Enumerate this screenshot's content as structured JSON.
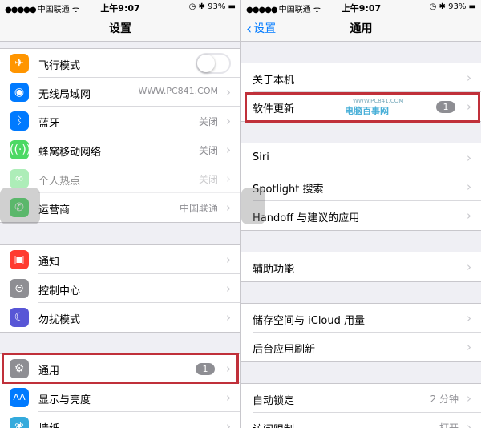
{
  "status_bar": {
    "carrier": "中国联通",
    "time": "上午9:07",
    "battery": "93%"
  },
  "left": {
    "title": "设置",
    "group1": [
      {
        "label": "飞行模式",
        "icon": "airplane-icon",
        "color": "#ff9500",
        "toggle": "off"
      },
      {
        "label": "无线局域网",
        "value": "WWW.PC841.COM",
        "icon": "wifi-icon",
        "color": "#007aff"
      },
      {
        "label": "蓝牙",
        "value": "关闭",
        "icon": "bluetooth-icon",
        "color": "#007aff"
      },
      {
        "label": "蜂窝移动网络",
        "value": "关闭",
        "icon": "cellular-icon",
        "color": "#4cd964"
      },
      {
        "label": "个人热点",
        "value": "关闭",
        "icon": "hotspot-icon",
        "color": "#4cd964"
      },
      {
        "label": "运营商",
        "value": "中国联通",
        "icon": "phone-icon",
        "color": "#4cd964"
      }
    ],
    "group2": [
      {
        "label": "通知",
        "icon": "notifications-icon",
        "color": "#ff3b30"
      },
      {
        "label": "控制中心",
        "icon": "control-center-icon",
        "color": "#8e8e93"
      },
      {
        "label": "勿扰模式",
        "icon": "moon-icon",
        "color": "#5856d6"
      }
    ],
    "group3": [
      {
        "label": "通用",
        "badge": "1",
        "icon": "gear-icon",
        "color": "#8e8e93"
      },
      {
        "label": "显示与亮度",
        "icon": "display-icon",
        "color": "#007aff"
      },
      {
        "label": "墙纸",
        "icon": "wallpaper-icon",
        "color": "#34aadc"
      }
    ]
  },
  "right": {
    "back_label": "设置",
    "title": "通用",
    "group1": [
      {
        "label": "关于本机"
      },
      {
        "label": "软件更新",
        "badge": "1"
      }
    ],
    "group2": [
      {
        "label": "Siri"
      },
      {
        "label": "Spotlight 搜索"
      },
      {
        "label": "Handoff 与建议的应用"
      }
    ],
    "group3": [
      {
        "label": "辅助功能"
      }
    ],
    "group4": [
      {
        "label": "储存空间与 iCloud 用量"
      },
      {
        "label": "后台应用刷新"
      }
    ],
    "group5": [
      {
        "label": "自动锁定",
        "value": "2 分钟"
      },
      {
        "label": "访问限制",
        "value": "打开"
      }
    ]
  },
  "watermark": {
    "main": "电脑百事网",
    "sub": "WWW.PC841.COM"
  },
  "highlight_color": "#c0303a"
}
